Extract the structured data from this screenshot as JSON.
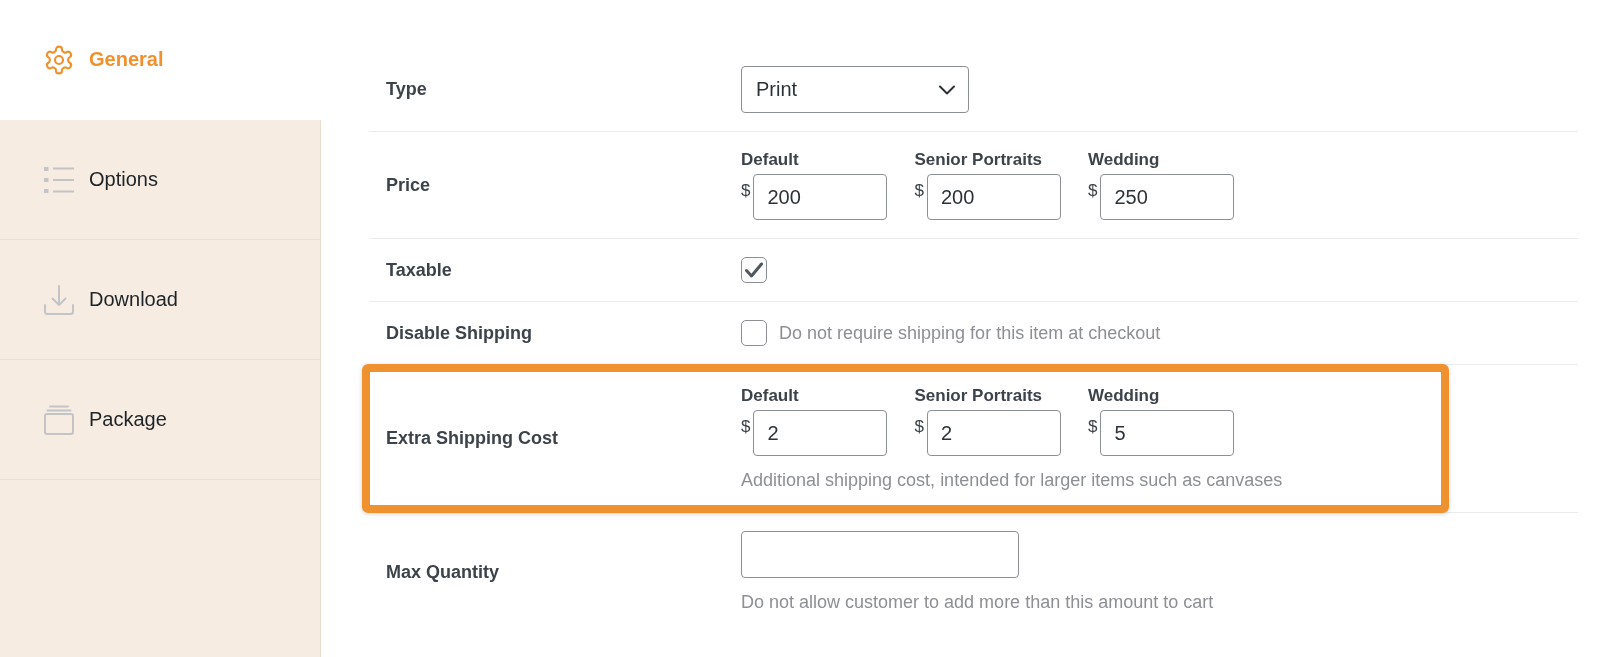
{
  "sidebar": {
    "items": [
      {
        "label": "General",
        "selected": true
      },
      {
        "label": "Options",
        "selected": false
      },
      {
        "label": "Download",
        "selected": false
      },
      {
        "label": "Package",
        "selected": false
      }
    ]
  },
  "form": {
    "rows": [
      {
        "kind": "select",
        "label": "Type",
        "value": "Print",
        "highlighted": false
      },
      {
        "kind": "prices",
        "label": "Price",
        "groups": [
          {
            "label": "Default",
            "currency": "$",
            "value": "200"
          },
          {
            "label": "Senior Portraits",
            "currency": "$",
            "value": "200"
          },
          {
            "label": "Wedding",
            "currency": "$",
            "value": "250"
          }
        ],
        "highlighted": false
      },
      {
        "kind": "checkbox",
        "label": "Taxable",
        "checked": true,
        "highlighted": false
      },
      {
        "kind": "checkbox",
        "label": "Disable Shipping",
        "checked": false,
        "text": "Do not require shipping for this item at checkout",
        "highlighted": false
      },
      {
        "kind": "prices",
        "label": "Extra Shipping Cost",
        "groups": [
          {
            "label": "Default",
            "currency": "$",
            "value": "2"
          },
          {
            "label": "Senior Portraits",
            "currency": "$",
            "value": "2"
          },
          {
            "label": "Wedding",
            "currency": "$",
            "value": "5"
          }
        ],
        "help": "Additional shipping cost, intended for larger items such as canvases",
        "highlighted": true
      },
      {
        "kind": "number",
        "label": "Max Quantity",
        "help": "Do not allow customer to add more than this amount to cart",
        "highlighted": false
      }
    ]
  }
}
